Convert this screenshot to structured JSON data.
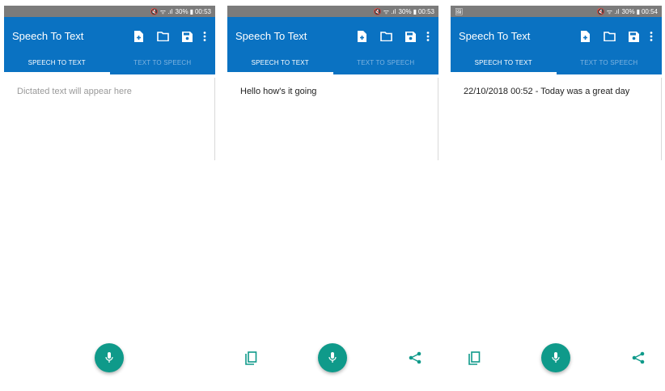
{
  "colors": {
    "primary": "#0a72c2",
    "accent": "#0f9a8a",
    "status_bar": "#7b7b7b",
    "tab_inactive": "#7fb4e0"
  },
  "screens": [
    {
      "status": {
        "left_icon": "",
        "icons": "🔇 ᯤ .ıl",
        "battery": "30%",
        "battery_icon": "▮",
        "time": "00:53"
      },
      "app_bar": {
        "title": "Speech To Text",
        "actions": [
          "new-file-icon",
          "folder-icon",
          "save-icon",
          "more-vert-icon"
        ]
      },
      "tabs": {
        "speech_to_text": "SPEECH TO TEXT",
        "text_to_speech": "TEXT TO SPEECH"
      },
      "editor": {
        "value": "",
        "placeholder": "Dictated text will appear here"
      },
      "fab_icon": "mic-icon",
      "bottom": {
        "copy": false,
        "share": false
      }
    },
    {
      "status": {
        "left_icon": "",
        "icons": "🔇 ᯤ .ıl",
        "battery": "30%",
        "battery_icon": "▮",
        "time": "00:53"
      },
      "app_bar": {
        "title": "Speech To Text",
        "actions": [
          "new-file-icon",
          "folder-icon",
          "save-icon",
          "more-vert-icon"
        ]
      },
      "tabs": {
        "speech_to_text": "SPEECH TO TEXT",
        "text_to_speech": "TEXT TO SPEECH"
      },
      "editor": {
        "value": "Hello how's it going",
        "placeholder": ""
      },
      "fab_icon": "mic-icon",
      "bottom": {
        "copy": true,
        "share": true
      }
    },
    {
      "status": {
        "left_icon": "🖼",
        "icons": "🔇 ᯤ .ıl",
        "battery": "30%",
        "battery_icon": "▮",
        "time": "00:54"
      },
      "app_bar": {
        "title": "Speech To Text",
        "actions": [
          "new-file-icon",
          "folder-icon",
          "save-icon",
          "more-vert-icon"
        ]
      },
      "tabs": {
        "speech_to_text": "SPEECH TO TEXT",
        "text_to_speech": "TEXT TO SPEECH"
      },
      "editor": {
        "value": "22/10/2018 00:52 - Today was a great day",
        "placeholder": ""
      },
      "fab_icon": "mic-icon",
      "bottom": {
        "copy": true,
        "share": true
      }
    }
  ]
}
